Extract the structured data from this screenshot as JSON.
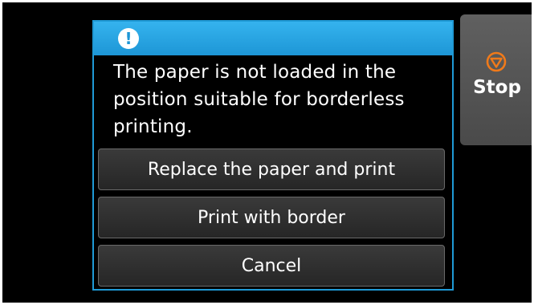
{
  "dialog": {
    "icon": "exclamation-icon",
    "message": "The paper is not loaded in the position suitable for borderless printing.",
    "buttons": {
      "replace": "Replace the paper and print",
      "with_border": "Print with border",
      "cancel": "Cancel"
    }
  },
  "stop": {
    "label": "Stop",
    "icon": "stop-icon",
    "icon_color": "#f07a1a"
  },
  "colors": {
    "header": "#1d96d6",
    "background": "#000000"
  }
}
